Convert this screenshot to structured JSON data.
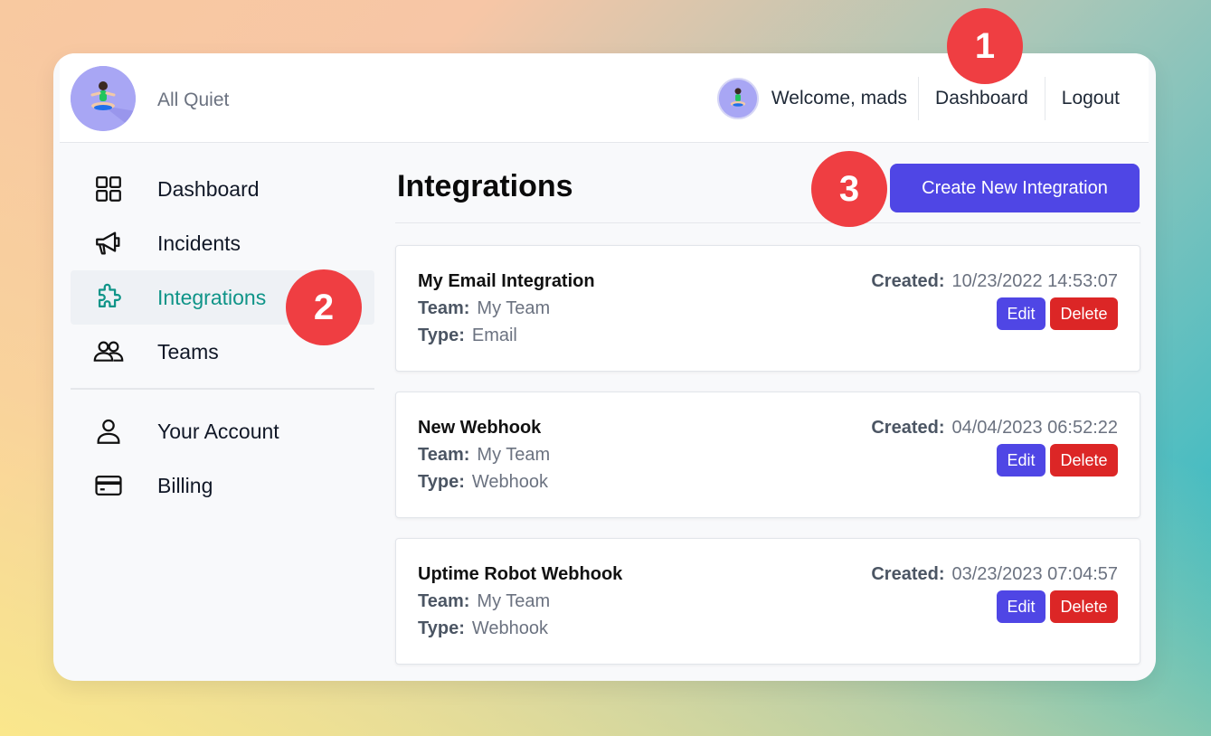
{
  "app": {
    "brand": "All Quiet"
  },
  "header": {
    "welcome": "Welcome, mads",
    "nav": [
      {
        "label": "Dashboard"
      },
      {
        "label": "Logout"
      }
    ]
  },
  "sidebar": {
    "items": [
      {
        "label": "Dashboard",
        "icon": "grid-icon"
      },
      {
        "label": "Incidents",
        "icon": "megaphone-icon"
      },
      {
        "label": "Integrations",
        "icon": "puzzle-icon",
        "active": true
      },
      {
        "label": "Teams",
        "icon": "users-icon"
      }
    ],
    "account_items": [
      {
        "label": "Your Account",
        "icon": "user-icon"
      },
      {
        "label": "Billing",
        "icon": "credit-card-icon"
      }
    ]
  },
  "main": {
    "title": "Integrations",
    "create_button": "Create New Integration",
    "labels": {
      "team": "Team:",
      "type": "Type:",
      "created": "Created:",
      "edit": "Edit",
      "delete": "Delete"
    },
    "integrations": [
      {
        "name": "My Email Integration",
        "team": "My Team",
        "type": "Email",
        "created": "10/23/2022 14:53:07"
      },
      {
        "name": "New Webhook",
        "team": "My Team",
        "type": "Webhook",
        "created": "04/04/2023 06:52:22"
      },
      {
        "name": "Uptime Robot Webhook",
        "team": "My Team",
        "type": "Webhook",
        "created": "03/23/2023 07:04:57"
      }
    ]
  },
  "badges": [
    "1",
    "2",
    "3"
  ],
  "colors": {
    "accent": "#4f46e5",
    "danger": "#dc2626",
    "active_text": "#0f9488",
    "badge": "#ef3e42"
  }
}
